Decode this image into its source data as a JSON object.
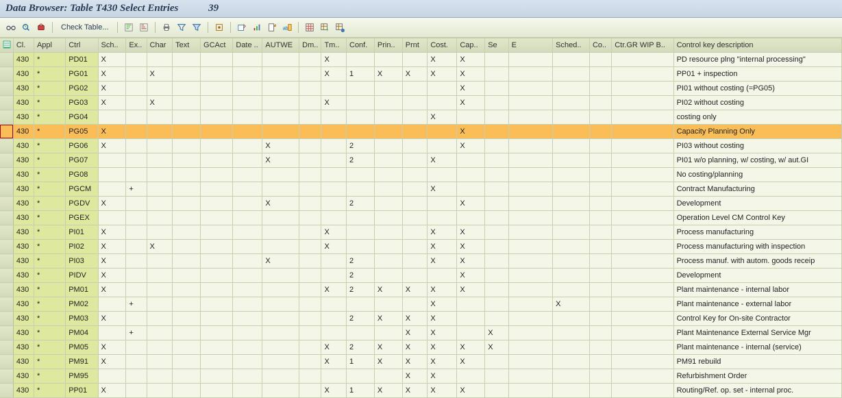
{
  "header": {
    "title": "Data Browser: Table T430 Select Entries",
    "count": "39"
  },
  "toolbar": {
    "check_table": "Check Table..."
  },
  "columns": [
    "",
    "Cl.",
    "Appl",
    "Ctrl",
    "Sch..",
    "Ex..",
    "Char",
    "Text",
    "GCAct",
    "Date ..",
    "AUTWE",
    "Dm..",
    "Tm..",
    "Conf.",
    "Prin..",
    "Prnt",
    "Cost.",
    "Cap..",
    "Se",
    "E",
    "Sched..",
    "Co..",
    "Ctr.GR WIP B..",
    "Control key description"
  ],
  "rows": [
    {
      "cl": "430",
      "appl": "*",
      "ctrl": "PD01",
      "sch": "X",
      "ex": "",
      "char": "",
      "text": "",
      "gcact": "",
      "date": "",
      "autwe": "",
      "dm": "",
      "tm": "X",
      "conf": "",
      "prin": "",
      "prnt": "",
      "cost": "X",
      "cap": "X",
      "se": "",
      "e": "",
      "sched": "",
      "co": "",
      "ctrgr": "",
      "desc": "PD resource plng \"internal processing\""
    },
    {
      "cl": "430",
      "appl": "*",
      "ctrl": "PG01",
      "sch": "X",
      "ex": "",
      "char": "X",
      "text": "",
      "gcact": "",
      "date": "",
      "autwe": "",
      "dm": "",
      "tm": "X",
      "conf": "1",
      "prin": "X",
      "prnt": "X",
      "cost": "X",
      "cap": "X",
      "se": "",
      "e": "",
      "sched": "",
      "co": "",
      "ctrgr": "",
      "desc": "PP01 + inspection"
    },
    {
      "cl": "430",
      "appl": "*",
      "ctrl": "PG02",
      "sch": "X",
      "ex": "",
      "char": "",
      "text": "",
      "gcact": "",
      "date": "",
      "autwe": "",
      "dm": "",
      "tm": "",
      "conf": "",
      "prin": "",
      "prnt": "",
      "cost": "",
      "cap": "X",
      "se": "",
      "e": "",
      "sched": "",
      "co": "",
      "ctrgr": "",
      "desc": "PI01 without costing (=PG05)"
    },
    {
      "cl": "430",
      "appl": "*",
      "ctrl": "PG03",
      "sch": "X",
      "ex": "",
      "char": "X",
      "text": "",
      "gcact": "",
      "date": "",
      "autwe": "",
      "dm": "",
      "tm": "X",
      "conf": "",
      "prin": "",
      "prnt": "",
      "cost": "",
      "cap": "X",
      "se": "",
      "e": "",
      "sched": "",
      "co": "",
      "ctrgr": "",
      "desc": "PI02 without costing"
    },
    {
      "cl": "430",
      "appl": "*",
      "ctrl": "PG04",
      "sch": "",
      "ex": "",
      "char": "",
      "text": "",
      "gcact": "",
      "date": "",
      "autwe": "",
      "dm": "",
      "tm": "",
      "conf": "",
      "prin": "",
      "prnt": "",
      "cost": "X",
      "cap": "",
      "se": "",
      "e": "",
      "sched": "",
      "co": "",
      "ctrgr": "",
      "desc": "costing only"
    },
    {
      "cl": "430",
      "appl": "*",
      "ctrl": "PG05",
      "sch": "X",
      "ex": "",
      "char": "",
      "text": "",
      "gcact": "",
      "date": "",
      "autwe": "",
      "dm": "",
      "tm": "",
      "conf": "",
      "prin": "",
      "prnt": "",
      "cost": "",
      "cap": "X",
      "se": "",
      "e": "",
      "sched": "",
      "co": "",
      "ctrgr": "",
      "desc": "Capacity Planning Only",
      "selected": true
    },
    {
      "cl": "430",
      "appl": "*",
      "ctrl": "PG06",
      "sch": "X",
      "ex": "",
      "char": "",
      "text": "",
      "gcact": "",
      "date": "",
      "autwe": "X",
      "dm": "",
      "tm": "",
      "conf": "2",
      "prin": "",
      "prnt": "",
      "cost": "",
      "cap": "X",
      "se": "",
      "e": "",
      "sched": "",
      "co": "",
      "ctrgr": "",
      "desc": "PI03 without costing"
    },
    {
      "cl": "430",
      "appl": "*",
      "ctrl": "PG07",
      "sch": "",
      "ex": "",
      "char": "",
      "text": "",
      "gcact": "",
      "date": "",
      "autwe": "X",
      "dm": "",
      "tm": "",
      "conf": "2",
      "prin": "",
      "prnt": "",
      "cost": "X",
      "cap": "",
      "se": "",
      "e": "",
      "sched": "",
      "co": "",
      "ctrgr": "",
      "desc": "PI01 w/o planning, w/ costing, w/ aut.GI"
    },
    {
      "cl": "430",
      "appl": "*",
      "ctrl": "PG08",
      "sch": "",
      "ex": "",
      "char": "",
      "text": "",
      "gcact": "",
      "date": "",
      "autwe": "",
      "dm": "",
      "tm": "",
      "conf": "",
      "prin": "",
      "prnt": "",
      "cost": "",
      "cap": "",
      "se": "",
      "e": "",
      "sched": "",
      "co": "",
      "ctrgr": "",
      "desc": "No costing/planning"
    },
    {
      "cl": "430",
      "appl": "*",
      "ctrl": "PGCM",
      "sch": "",
      "ex": "+",
      "char": "",
      "text": "",
      "gcact": "",
      "date": "",
      "autwe": "",
      "dm": "",
      "tm": "",
      "conf": "",
      "prin": "",
      "prnt": "",
      "cost": "X",
      "cap": "",
      "se": "",
      "e": "",
      "sched": "",
      "co": "",
      "ctrgr": "",
      "desc": "Contract Manufacturing"
    },
    {
      "cl": "430",
      "appl": "*",
      "ctrl": "PGDV",
      "sch": "X",
      "ex": "",
      "char": "",
      "text": "",
      "gcact": "",
      "date": "",
      "autwe": "X",
      "dm": "",
      "tm": "",
      "conf": "2",
      "prin": "",
      "prnt": "",
      "cost": "",
      "cap": "X",
      "se": "",
      "e": "",
      "sched": "",
      "co": "",
      "ctrgr": "",
      "desc": "Development"
    },
    {
      "cl": "430",
      "appl": "*",
      "ctrl": "PGEX",
      "sch": "",
      "ex": "",
      "char": "",
      "text": "",
      "gcact": "",
      "date": "",
      "autwe": "",
      "dm": "",
      "tm": "",
      "conf": "",
      "prin": "",
      "prnt": "",
      "cost": "",
      "cap": "",
      "se": "",
      "e": "",
      "sched": "",
      "co": "",
      "ctrgr": "",
      "desc": "Operation Level CM Control Key"
    },
    {
      "cl": "430",
      "appl": "*",
      "ctrl": "PI01",
      "sch": "X",
      "ex": "",
      "char": "",
      "text": "",
      "gcact": "",
      "date": "",
      "autwe": "",
      "dm": "",
      "tm": "X",
      "conf": "",
      "prin": "",
      "prnt": "",
      "cost": "X",
      "cap": "X",
      "se": "",
      "e": "",
      "sched": "",
      "co": "",
      "ctrgr": "",
      "desc": "Process manufacturing"
    },
    {
      "cl": "430",
      "appl": "*",
      "ctrl": "PI02",
      "sch": "X",
      "ex": "",
      "char": "X",
      "text": "",
      "gcact": "",
      "date": "",
      "autwe": "",
      "dm": "",
      "tm": "X",
      "conf": "",
      "prin": "",
      "prnt": "",
      "cost": "X",
      "cap": "X",
      "se": "",
      "e": "",
      "sched": "",
      "co": "",
      "ctrgr": "",
      "desc": "Process manufacturing with inspection"
    },
    {
      "cl": "430",
      "appl": "*",
      "ctrl": "PI03",
      "sch": "X",
      "ex": "",
      "char": "",
      "text": "",
      "gcact": "",
      "date": "",
      "autwe": "X",
      "dm": "",
      "tm": "",
      "conf": "2",
      "prin": "",
      "prnt": "",
      "cost": "X",
      "cap": "X",
      "se": "",
      "e": "",
      "sched": "",
      "co": "",
      "ctrgr": "",
      "desc": "Process manuf. with autom. goods receip"
    },
    {
      "cl": "430",
      "appl": "*",
      "ctrl": "PIDV",
      "sch": "X",
      "ex": "",
      "char": "",
      "text": "",
      "gcact": "",
      "date": "",
      "autwe": "",
      "dm": "",
      "tm": "",
      "conf": "2",
      "prin": "",
      "prnt": "",
      "cost": "",
      "cap": "X",
      "se": "",
      "e": "",
      "sched": "",
      "co": "",
      "ctrgr": "",
      "desc": "Development"
    },
    {
      "cl": "430",
      "appl": "*",
      "ctrl": "PM01",
      "sch": "X",
      "ex": "",
      "char": "",
      "text": "",
      "gcact": "",
      "date": "",
      "autwe": "",
      "dm": "",
      "tm": "X",
      "conf": "2",
      "prin": "X",
      "prnt": "X",
      "cost": "X",
      "cap": "X",
      "se": "",
      "e": "",
      "sched": "",
      "co": "",
      "ctrgr": "",
      "desc": "Plant maintenance - internal labor"
    },
    {
      "cl": "430",
      "appl": "*",
      "ctrl": "PM02",
      "sch": "",
      "ex": "+",
      "char": "",
      "text": "",
      "gcact": "",
      "date": "",
      "autwe": "",
      "dm": "",
      "tm": "",
      "conf": "",
      "prin": "",
      "prnt": "",
      "cost": "X",
      "cap": "",
      "se": "",
      "e": "",
      "sched": "X",
      "co": "",
      "ctrgr": "",
      "desc": "Plant maintenance - external labor"
    },
    {
      "cl": "430",
      "appl": "*",
      "ctrl": "PM03",
      "sch": "X",
      "ex": "",
      "char": "",
      "text": "",
      "gcact": "",
      "date": "",
      "autwe": "",
      "dm": "",
      "tm": "",
      "conf": "2",
      "prin": "X",
      "prnt": "X",
      "cost": "X",
      "cap": "",
      "se": "",
      "e": "",
      "sched": "",
      "co": "",
      "ctrgr": "",
      "desc": "Control Key for On-site Contractor"
    },
    {
      "cl": "430",
      "appl": "*",
      "ctrl": "PM04",
      "sch": "",
      "ex": "+",
      "char": "",
      "text": "",
      "gcact": "",
      "date": "",
      "autwe": "",
      "dm": "",
      "tm": "",
      "conf": "",
      "prin": "",
      "prnt": "X",
      "cost": "X",
      "cap": "",
      "se": "X",
      "e": "",
      "sched": "",
      "co": "",
      "ctrgr": "",
      "desc": "Plant Maintenance External Service Mgr"
    },
    {
      "cl": "430",
      "appl": "*",
      "ctrl": "PM05",
      "sch": "X",
      "ex": "",
      "char": "",
      "text": "",
      "gcact": "",
      "date": "",
      "autwe": "",
      "dm": "",
      "tm": "X",
      "conf": "2",
      "prin": "X",
      "prnt": "X",
      "cost": "X",
      "cap": "X",
      "se": "X",
      "e": "",
      "sched": "",
      "co": "",
      "ctrgr": "",
      "desc": "Plant maintenance - internal (service)"
    },
    {
      "cl": "430",
      "appl": "*",
      "ctrl": "PM91",
      "sch": "X",
      "ex": "",
      "char": "",
      "text": "",
      "gcact": "",
      "date": "",
      "autwe": "",
      "dm": "",
      "tm": "X",
      "conf": "1",
      "prin": "X",
      "prnt": "X",
      "cost": "X",
      "cap": "X",
      "se": "",
      "e": "",
      "sched": "",
      "co": "",
      "ctrgr": "",
      "desc": "PM91 rebuild"
    },
    {
      "cl": "430",
      "appl": "*",
      "ctrl": "PM95",
      "sch": "",
      "ex": "",
      "char": "",
      "text": "",
      "gcact": "",
      "date": "",
      "autwe": "",
      "dm": "",
      "tm": "",
      "conf": "",
      "prin": "",
      "prnt": "X",
      "cost": "X",
      "cap": "",
      "se": "",
      "e": "",
      "sched": "",
      "co": "",
      "ctrgr": "",
      "desc": "Refurbishment Order"
    },
    {
      "cl": "430",
      "appl": "*",
      "ctrl": "PP01",
      "sch": "X",
      "ex": "",
      "char": "",
      "text": "",
      "gcact": "",
      "date": "",
      "autwe": "",
      "dm": "",
      "tm": "X",
      "conf": "1",
      "prin": "X",
      "prnt": "X",
      "cost": "X",
      "cap": "X",
      "se": "",
      "e": "",
      "sched": "",
      "co": "",
      "ctrgr": "",
      "desc": "Routing/Ref. op. set - internal proc."
    }
  ]
}
